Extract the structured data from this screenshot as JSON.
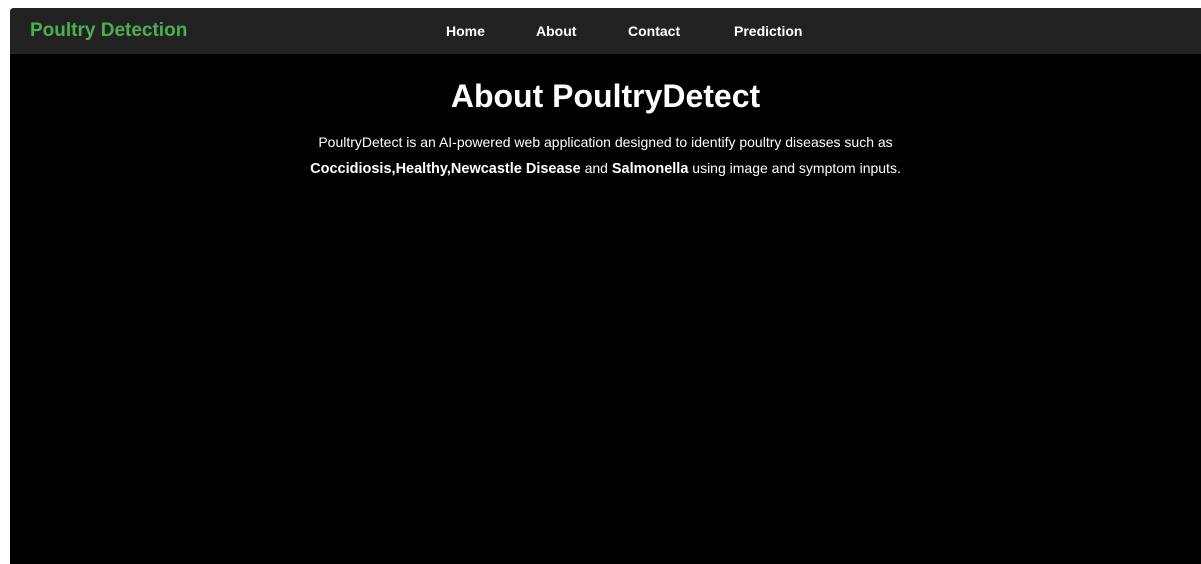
{
  "navbar": {
    "brand": "Poultry Detection",
    "links": [
      "Home",
      "About",
      "Contact",
      "Prediction"
    ]
  },
  "main": {
    "title": "About PoultryDetect",
    "description": {
      "intro": "PoultryDetect is an AI-powered web application designed to identify poultry diseases such as ",
      "disease_1": "Coccidiosis",
      "sep_1": ",",
      "disease_2": "Healthy",
      "sep_2": ",",
      "disease_3": "Newcastle Disease",
      "sep_3": " and ",
      "disease_4": "Salmonella",
      "outro": " using image and symptom inputs."
    }
  },
  "colors": {
    "brand": "#4caf50",
    "navbar_bg": "#222222",
    "page_bg": "#000000",
    "text": "#ffffff"
  }
}
